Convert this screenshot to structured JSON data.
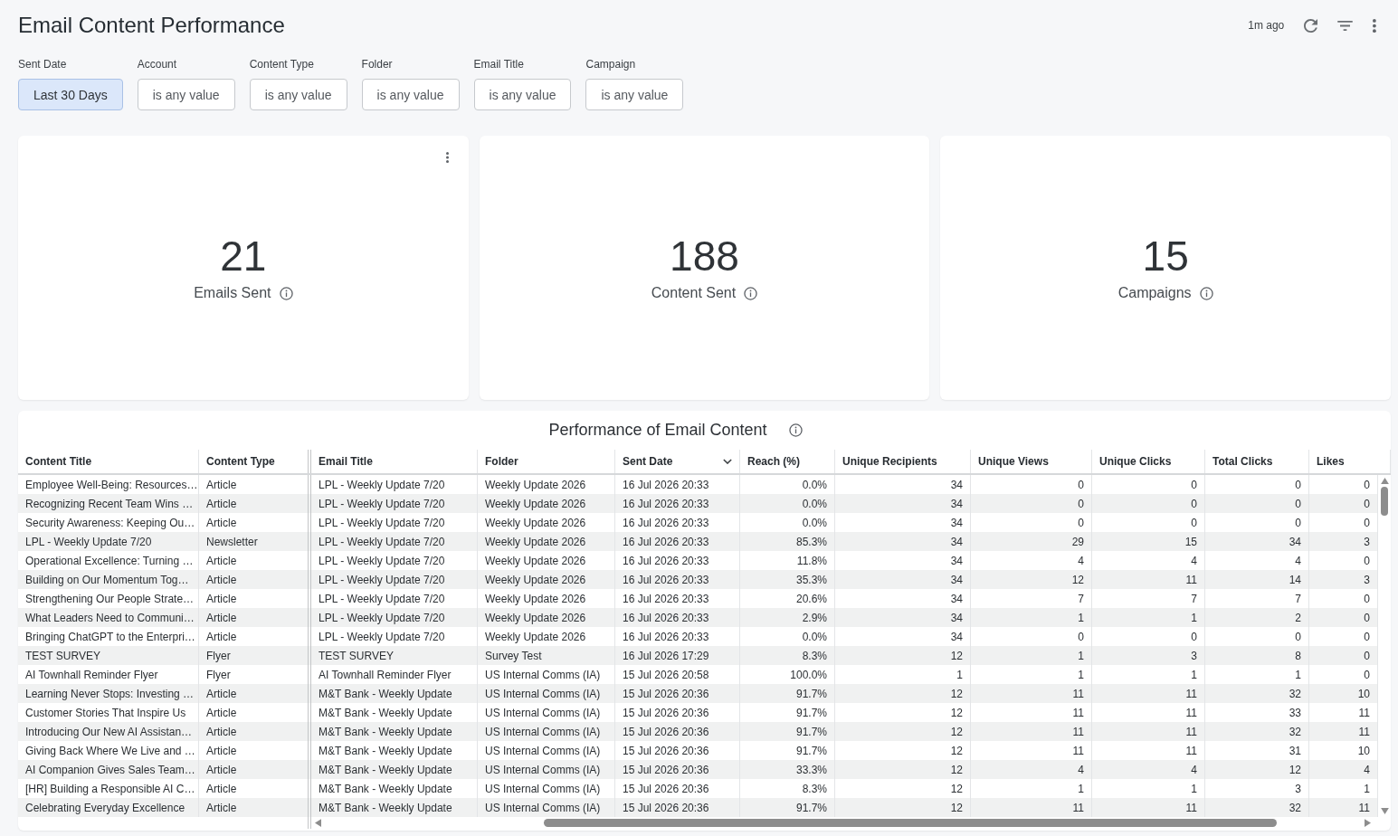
{
  "header": {
    "title": "Email Content Performance",
    "updated": "1m ago"
  },
  "filters": [
    {
      "label": "Sent Date",
      "value": "Last 30 Days",
      "active": true
    },
    {
      "label": "Account",
      "value": "is any value",
      "active": false
    },
    {
      "label": "Content Type",
      "value": "is any value",
      "active": false
    },
    {
      "label": "Folder",
      "value": "is any value",
      "active": false
    },
    {
      "label": "Email Title",
      "value": "is any value",
      "active": false
    },
    {
      "label": "Campaign",
      "value": "is any value",
      "active": false
    }
  ],
  "tiles": [
    {
      "value": "21",
      "label": "Emails Sent",
      "menu": true
    },
    {
      "value": "188",
      "label": "Content Sent",
      "menu": false
    },
    {
      "value": "15",
      "label": "Campaigns",
      "menu": false
    }
  ],
  "table": {
    "title": "Performance of Email Content",
    "columns": [
      {
        "label": "Content Title",
        "kind": "text",
        "pinned": true,
        "sorted": false
      },
      {
        "label": "Content Type",
        "kind": "text",
        "pinned": true,
        "sorted": false
      },
      {
        "label": "Email Title",
        "kind": "text",
        "pinned": false,
        "sorted": false
      },
      {
        "label": "Folder",
        "kind": "text",
        "pinned": false,
        "sorted": false
      },
      {
        "label": "Sent Date",
        "kind": "text",
        "pinned": false,
        "sorted": true
      },
      {
        "label": "Reach (%)",
        "kind": "number",
        "pinned": false,
        "sorted": false
      },
      {
        "label": "Unique Recipients",
        "kind": "number",
        "pinned": false,
        "sorted": false
      },
      {
        "label": "Unique Views",
        "kind": "number",
        "pinned": false,
        "sorted": false
      },
      {
        "label": "Unique Clicks",
        "kind": "number",
        "pinned": false,
        "sorted": false
      },
      {
        "label": "Total Clicks",
        "kind": "number",
        "pinned": false,
        "sorted": false
      },
      {
        "label": "Likes",
        "kind": "number",
        "pinned": false,
        "sorted": false
      }
    ],
    "rows": [
      [
        "Employee Well-Being: Resources…",
        "Article",
        "LPL - Weekly Update 7/20",
        "Weekly Update 2026",
        "16 Jul 2026 20:33",
        "0.0%",
        "34",
        "0",
        "0",
        "0",
        "0"
      ],
      [
        "Recognizing Recent Team Wins …",
        "Article",
        "LPL - Weekly Update 7/20",
        "Weekly Update 2026",
        "16 Jul 2026 20:33",
        "0.0%",
        "34",
        "0",
        "0",
        "0",
        "0"
      ],
      [
        "Security Awareness: Keeping Ou…",
        "Article",
        "LPL - Weekly Update 7/20",
        "Weekly Update 2026",
        "16 Jul 2026 20:33",
        "0.0%",
        "34",
        "0",
        "0",
        "0",
        "0"
      ],
      [
        "LPL - Weekly Update 7/20",
        "Newsletter",
        "LPL - Weekly Update 7/20",
        "Weekly Update 2026",
        "16 Jul 2026 20:33",
        "85.3%",
        "34",
        "29",
        "15",
        "34",
        "3"
      ],
      [
        "Operational Excellence: Turning …",
        "Article",
        "LPL - Weekly Update 7/20",
        "Weekly Update 2026",
        "16 Jul 2026 20:33",
        "11.8%",
        "34",
        "4",
        "4",
        "4",
        "0"
      ],
      [
        "Building on Our Momentum Tog…",
        "Article",
        "LPL - Weekly Update 7/20",
        "Weekly Update 2026",
        "16 Jul 2026 20:33",
        "35.3%",
        "34",
        "12",
        "11",
        "14",
        "3"
      ],
      [
        "Strengthening Our People Strate…",
        "Article",
        "LPL - Weekly Update 7/20",
        "Weekly Update 2026",
        "16 Jul 2026 20:33",
        "20.6%",
        "34",
        "7",
        "7",
        "7",
        "0"
      ],
      [
        "What Leaders Need to Communi…",
        "Article",
        "LPL - Weekly Update 7/20",
        "Weekly Update 2026",
        "16 Jul 2026 20:33",
        "2.9%",
        "34",
        "1",
        "1",
        "2",
        "0"
      ],
      [
        "Bringing ChatGPT to the Enterpri…",
        "Article",
        "LPL - Weekly Update 7/20",
        "Weekly Update 2026",
        "16 Jul 2026 20:33",
        "0.0%",
        "34",
        "0",
        "0",
        "0",
        "0"
      ],
      [
        "TEST SURVEY",
        "Flyer",
        "TEST SURVEY",
        "Survey Test",
        "16 Jul 2026 17:29",
        "8.3%",
        "12",
        "1",
        "3",
        "8",
        "0"
      ],
      [
        "AI Townhall Reminder Flyer",
        "Flyer",
        "AI Townhall Reminder Flyer",
        "US Internal Comms (IA)",
        "15 Jul 2026 20:58",
        "100.0%",
        "1",
        "1",
        "1",
        "1",
        "0"
      ],
      [
        "Learning Never Stops: Investing …",
        "Article",
        "M&T Bank - Weekly Update",
        "US Internal Comms (IA)",
        "15 Jul 2026 20:36",
        "91.7%",
        "12",
        "11",
        "11",
        "32",
        "10"
      ],
      [
        "Customer Stories That Inspire Us",
        "Article",
        "M&T Bank - Weekly Update",
        "US Internal Comms (IA)",
        "15 Jul 2026 20:36",
        "91.7%",
        "12",
        "11",
        "11",
        "33",
        "11"
      ],
      [
        "Introducing Our New AI Assistan…",
        "Article",
        "M&T Bank - Weekly Update",
        "US Internal Comms (IA)",
        "15 Jul 2026 20:36",
        "91.7%",
        "12",
        "11",
        "11",
        "32",
        "11"
      ],
      [
        "Giving Back Where We Live and …",
        "Article",
        "M&T Bank - Weekly Update",
        "US Internal Comms (IA)",
        "15 Jul 2026 20:36",
        "91.7%",
        "12",
        "11",
        "11",
        "31",
        "10"
      ],
      [
        "AI Companion Gives Sales Team…",
        "Article",
        "M&T Bank - Weekly Update",
        "US Internal Comms (IA)",
        "15 Jul 2026 20:36",
        "33.3%",
        "12",
        "4",
        "4",
        "12",
        "4"
      ],
      [
        "[HR] Building a Responsible AI C…",
        "Article",
        "M&T Bank - Weekly Update",
        "US Internal Comms (IA)",
        "15 Jul 2026 20:36",
        "8.3%",
        "12",
        "1",
        "1",
        "3",
        "1"
      ],
      [
        "Celebrating Everyday Excellence",
        "Article",
        "M&T Bank - Weekly Update",
        "US Internal Comms (IA)",
        "15 Jul 2026 20:36",
        "91.7%",
        "12",
        "11",
        "11",
        "32",
        "11"
      ]
    ]
  }
}
